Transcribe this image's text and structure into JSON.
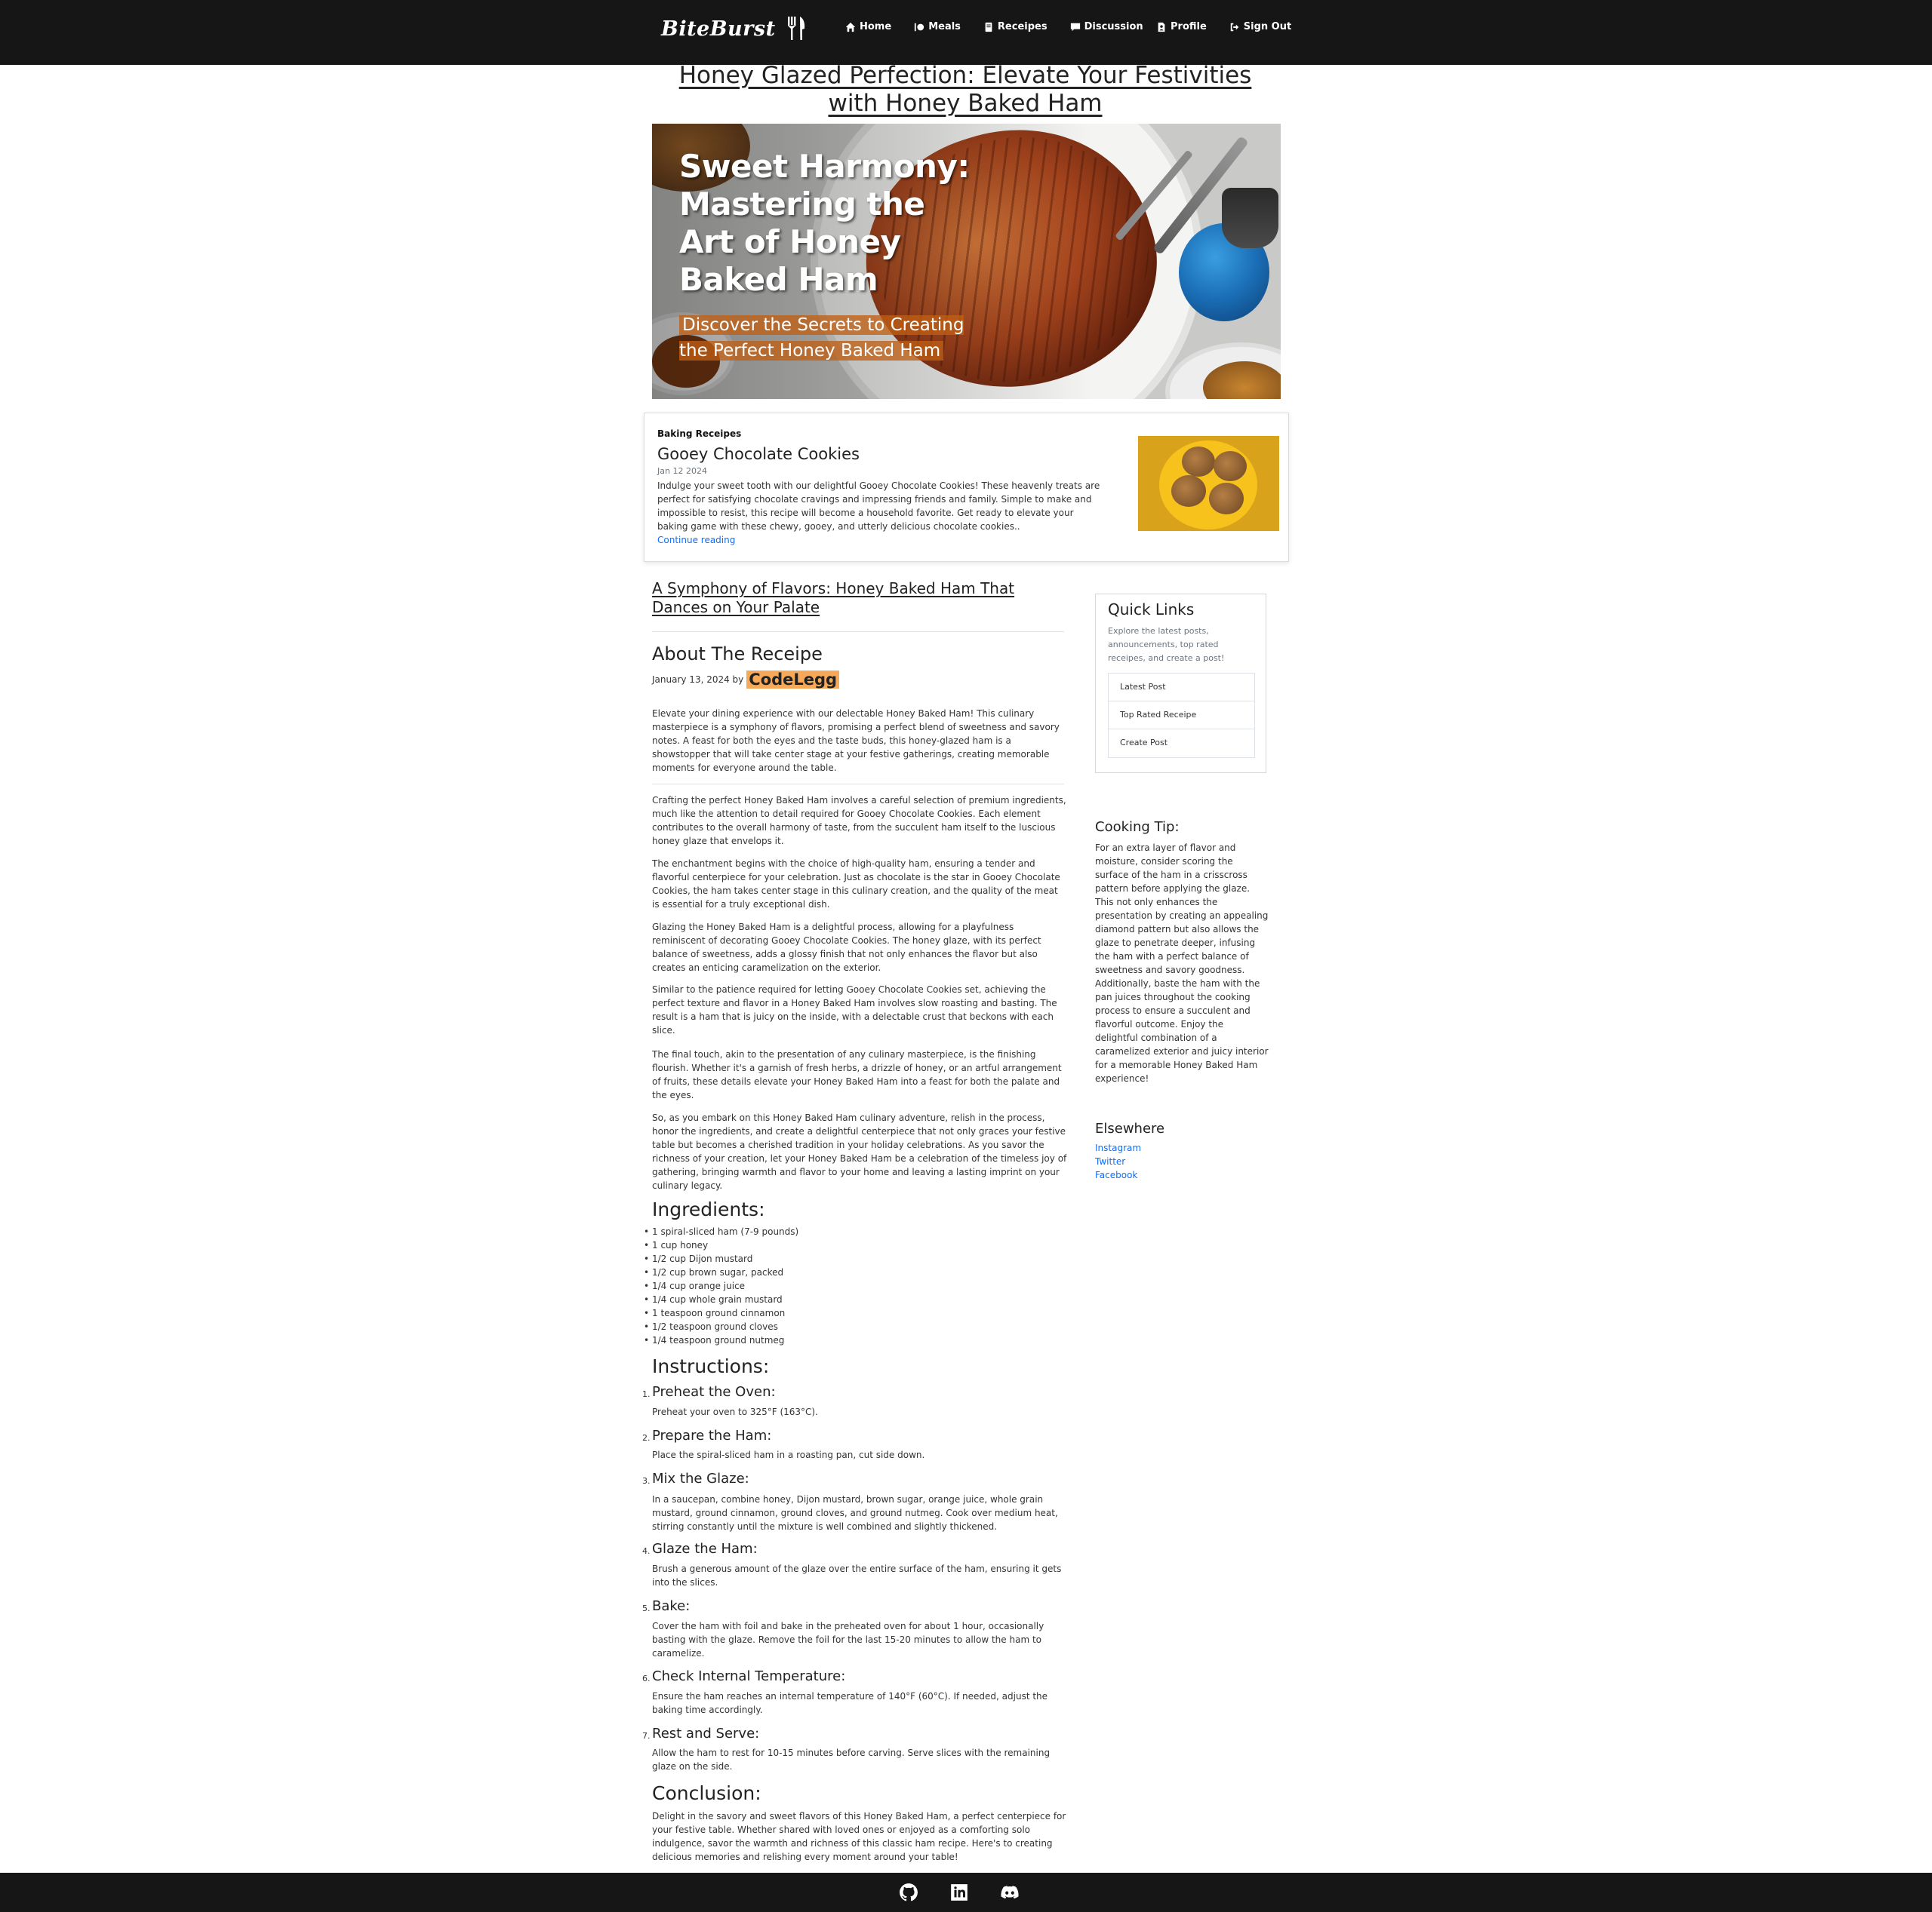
{
  "nav": {
    "brand": "BiteBurst",
    "items": [
      {
        "label": "Home",
        "icon": "home-icon"
      },
      {
        "label": "Meals",
        "icon": "meals-icon"
      },
      {
        "label": "Receipes",
        "icon": "book-icon"
      },
      {
        "label": "Discussion",
        "icon": "comment-icon"
      }
    ],
    "right_items": [
      {
        "label": "Profile",
        "icon": "profile-icon"
      },
      {
        "label": "Sign Out",
        "icon": "sign-out-icon"
      }
    ]
  },
  "main": {
    "title": "Honey Glazed Perfection: Elevate Your Festivities with Honey Baked Ham",
    "hero": {
      "headline": "Sweet Harmony: Mastering the Art of Honey Baked Ham",
      "subheadline": "Discover the Secrets to Creating the Perfect Honey Baked Ham"
    }
  },
  "featured": {
    "category": "Baking Receipes",
    "title": "Gooey Chocolate Cookies",
    "date": "Jan 12 2024",
    "excerpt": "Indulge your sweet tooth with our delightful Gooey Chocolate Cookies! These heavenly treats are perfect for satisfying chocolate cravings and impressing friends and family. Simple to make and impossible to resist, this recipe will become a household favorite. Get ready to elevate your baking game with these chewy, gooey, and utterly delicious chocolate cookies..",
    "link": "Continue reading"
  },
  "post": {
    "heading": "A Symphony of Flavors: Honey Baked Ham That Dances on Your Palate",
    "about_title": "About The Receipe",
    "date": "January 13, 2024 by",
    "author": "CodeLegg",
    "intro": "Elevate your dining experience with our delectable Honey Baked Ham! This culinary masterpiece is a symphony of flavors, promising a perfect blend of sweetness and savory notes. A feast for both the eyes and the taste buds, this honey-glazed ham is a showstopper that will take center stage at your festive gatherings, creating memorable moments for everyone around the table.",
    "paragraphs": [
      "Crafting the perfect Honey Baked Ham involves a careful selection of premium ingredients, much like the attention to detail required for Gooey Chocolate Cookies. Each element contributes to the overall harmony of taste, from the succulent ham itself to the luscious honey glaze that envelops it.",
      "The enchantment begins with the choice of high-quality ham, ensuring a tender and flavorful centerpiece for your celebration. Just as chocolate is the star in Gooey Chocolate Cookies, the ham takes center stage in this culinary creation, and the quality of the meat is essential for a truly exceptional dish.",
      "Glazing the Honey Baked Ham is a delightful process, allowing for a playfulness reminiscent of decorating Gooey Chocolate Cookies. The honey glaze, with its perfect balance of sweetness, adds a glossy finish that not only enhances the flavor but also creates an enticing caramelization on the exterior.",
      "Similar to the patience required for letting Gooey Chocolate Cookies set, achieving the perfect texture and flavor in a Honey Baked Ham involves slow roasting and basting. The result is a ham that is juicy on the inside, with a delectable crust that beckons with each slice.",
      "The final touch, akin to the presentation of any culinary masterpiece, is the finishing flourish. Whether it's a garnish of fresh herbs, a drizzle of honey, or an artful arrangement of fruits, these details elevate your Honey Baked Ham into a feast for both the palate and the eyes.",
      "So, as you embark on this Honey Baked Ham culinary adventure, relish in the process, honor the ingredients, and create a delightful centerpiece that not only graces your festive table but becomes a cherished tradition in your holiday celebrations. As you savor the richness of your creation, let your Honey Baked Ham be a celebration of the timeless joy of gathering, bringing warmth and flavor to your home and leaving a lasting imprint on your culinary legacy."
    ],
    "ingredients_title": "Ingredients:",
    "ingredients": [
      "1 spiral-sliced ham (7-9 pounds)",
      "1 cup honey",
      "1/2 cup Dijon mustard",
      "1/2 cup brown sugar, packed",
      "1/4 cup orange juice",
      "1/4 cup whole grain mustard",
      "1 teaspoon ground cinnamon",
      "1/2 teaspoon ground cloves",
      "1/4 teaspoon ground nutmeg"
    ],
    "instructions_title": "Instructions:",
    "steps": [
      {
        "num": "1.",
        "title": "Preheat the Oven:",
        "text": "Preheat your oven to 325°F (163°C)."
      },
      {
        "num": "2.",
        "title": "Prepare the Ham:",
        "text": "Place the spiral-sliced ham in a roasting pan, cut side down."
      },
      {
        "num": "3.",
        "title": "Mix the Glaze:",
        "text": "In a saucepan, combine honey, Dijon mustard, brown sugar, orange juice, whole grain mustard, ground cinnamon, ground cloves, and ground nutmeg. Cook over medium heat, stirring constantly until the mixture is well combined and slightly thickened."
      },
      {
        "num": "4.",
        "title": "Glaze the Ham:",
        "text": "Brush a generous amount of the glaze over the entire surface of the ham, ensuring it gets into the slices."
      },
      {
        "num": "5.",
        "title": "Bake:",
        "text": "Cover the ham with foil and bake in the preheated oven for about 1 hour, occasionally basting with the glaze. Remove the foil for the last 15-20 minutes to allow the ham to caramelize."
      },
      {
        "num": "6.",
        "title": "Check Internal Temperature:",
        "text": "Ensure the ham reaches an internal temperature of 140°F (60°C). If needed, adjust the baking time accordingly."
      },
      {
        "num": "7.",
        "title": "Rest and Serve:",
        "text": "Allow the ham to rest for 10-15 minutes before carving. Serve slices with the remaining glaze on the side."
      }
    ],
    "conclusion_title": "Conclusion:",
    "conclusion": "Delight in the savory and sweet flavors of this Honey Baked Ham, a perfect centerpiece for your festive table. Whether shared with loved ones or enjoyed as a comforting solo indulgence, savor the warmth and richness of this classic ham recipe. Here's to creating delicious memories and relishing every moment around your table!"
  },
  "sidebar": {
    "quick_links_title": "Quick Links",
    "quick_links_desc": "Explore the latest posts, announcements, top rated receipes, and create a post!",
    "quick_links": [
      "Latest Post",
      "Top Rated Receipe",
      "Create Post"
    ],
    "tip_title": "Cooking Tip:",
    "tip_text": "For an extra layer of flavor and moisture, consider scoring the surface of the ham in a crisscross pattern before applying the glaze. This not only enhances the presentation by creating an appealing diamond pattern but also allows the glaze to penetrate deeper, infusing the ham with a perfect balance of sweetness and savory goodness. Additionally, baste the ham with the pan juices throughout the cooking process to ensure a succulent and flavorful outcome. Enjoy the delightful combination of a caramelized exterior and juicy interior for a memorable Honey Baked Ham experience!",
    "elsewhere_title": "Elsewhere",
    "elsewhere_links": [
      "Instagram",
      "Twitter",
      "Facebook"
    ]
  },
  "footer": {
    "icons": [
      "github-icon",
      "linkedin-icon",
      "discord-icon"
    ]
  },
  "colors": {
    "navbar_bg": "#161616",
    "link": "#0d6efd",
    "author_highlight": "#f7a95a",
    "hero_sub_highlight": "#bf5f14"
  }
}
